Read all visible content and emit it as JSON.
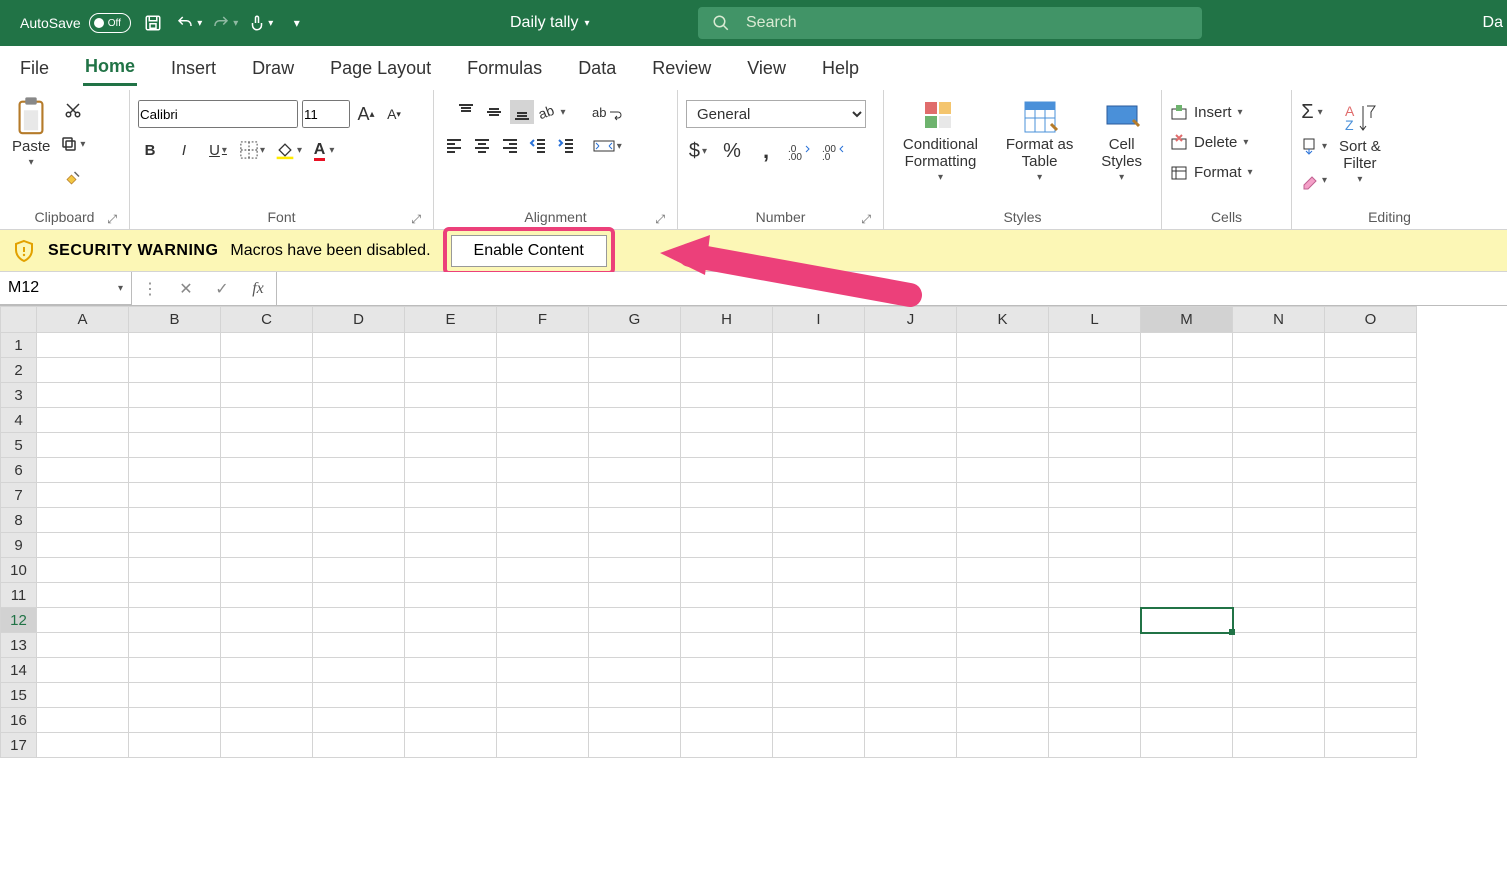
{
  "titlebar": {
    "autosave_label": "AutoSave",
    "autosave_state": "Off",
    "doc_name": "Daily tally",
    "search_placeholder": "Search",
    "right_cut": "Da"
  },
  "tabs": [
    "File",
    "Home",
    "Insert",
    "Draw",
    "Page Layout",
    "Formulas",
    "Data",
    "Review",
    "View",
    "Help"
  ],
  "active_tab": "Home",
  "ribbon": {
    "clipboard": {
      "label": "Clipboard",
      "paste": "Paste"
    },
    "font": {
      "label": "Font",
      "name": "Calibri",
      "size": "11",
      "B": "B",
      "I": "I",
      "U": "U"
    },
    "alignment": {
      "label": "Alignment",
      "wrap": "ab"
    },
    "number": {
      "label": "Number",
      "format": "General",
      "dollar": "$",
      "percent": "%",
      "comma": ",",
      "inc": ".00",
      "dec": ".0"
    },
    "styles": {
      "label": "Styles",
      "cond": "Conditional\nFormatting",
      "table": "Format as\nTable",
      "cell": "Cell\nStyles"
    },
    "cells": {
      "label": "Cells",
      "insert": "Insert",
      "delete": "Delete",
      "format": "Format"
    },
    "editing": {
      "label": "Editing",
      "sort": "Sort &\nFilter"
    }
  },
  "warning": {
    "title": "SECURITY WARNING",
    "text": "Macros have been disabled.",
    "button": "Enable Content"
  },
  "formula": {
    "name_box": "M12",
    "value": ""
  },
  "grid": {
    "cols": [
      "A",
      "B",
      "C",
      "D",
      "E",
      "F",
      "G",
      "H",
      "I",
      "J",
      "K",
      "L",
      "M",
      "N",
      "O"
    ],
    "rows": 17,
    "active_col": "M",
    "active_row": 12
  }
}
